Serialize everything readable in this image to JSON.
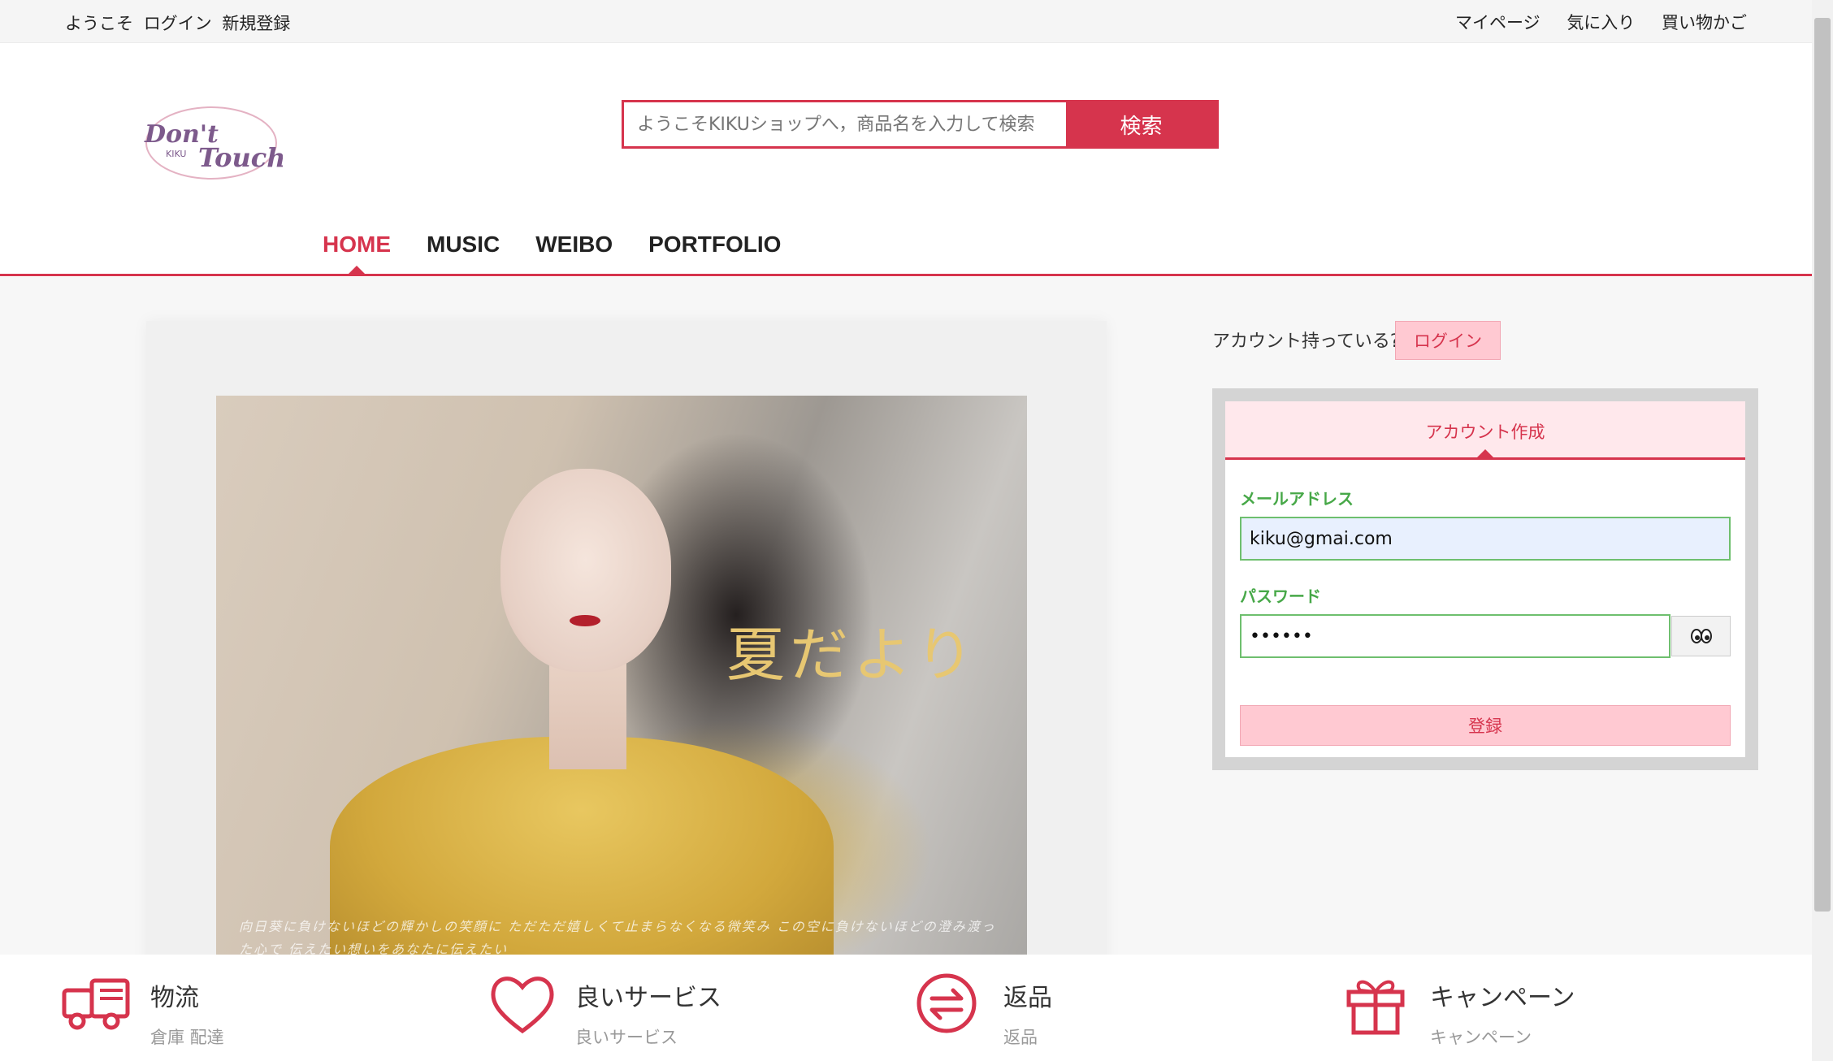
{
  "topbar": {
    "welcome": "ようこそ",
    "login": "ログイン",
    "register": "新規登録",
    "mypage": "マイページ",
    "favorites": "気に入り",
    "cart": "買い物かご"
  },
  "logo": {
    "line1": "Don't",
    "line2": "Touch",
    "brand": "KIKU"
  },
  "search": {
    "placeholder": "ようこそKIKUショップへ，商品名を入力して検索",
    "button_label": "検索"
  },
  "nav": {
    "items": [
      {
        "label": "HOME",
        "active": true
      },
      {
        "label": "MUSIC",
        "active": false
      },
      {
        "label": "WEIBO",
        "active": false
      },
      {
        "label": "PORTFOLIO",
        "active": false
      }
    ]
  },
  "banner": {
    "title": "夏だより",
    "caption": "向日葵に負けないほどの輝かしの笑顔に ただただ嬉しくて止まらなくなる微笑み この空に負けないほどの澄み渡った心で 伝えたい想いをあなたに伝えたい"
  },
  "account": {
    "question": "アカウント持っている?",
    "login_button": "ログイン",
    "tab_label": "アカウント作成",
    "email_label": "メールアドレス",
    "email_value": "kiku@gmai.com",
    "password_label": "パスワード",
    "password_value": "••••••",
    "submit_label": "登録"
  },
  "features": [
    {
      "title": "物流",
      "subtitle": "倉庫 配達",
      "icon": "truck-icon"
    },
    {
      "title": "良いサービス",
      "subtitle": "良いサービス",
      "icon": "heart-icon"
    },
    {
      "title": "返品",
      "subtitle": "返品",
      "icon": "return-icon"
    },
    {
      "title": "キャンペーン",
      "subtitle": "キャンペーン",
      "icon": "gift-icon"
    }
  ],
  "colors": {
    "accent": "#d6344d",
    "pink": "#ffc9d2",
    "green": "#47a848"
  }
}
